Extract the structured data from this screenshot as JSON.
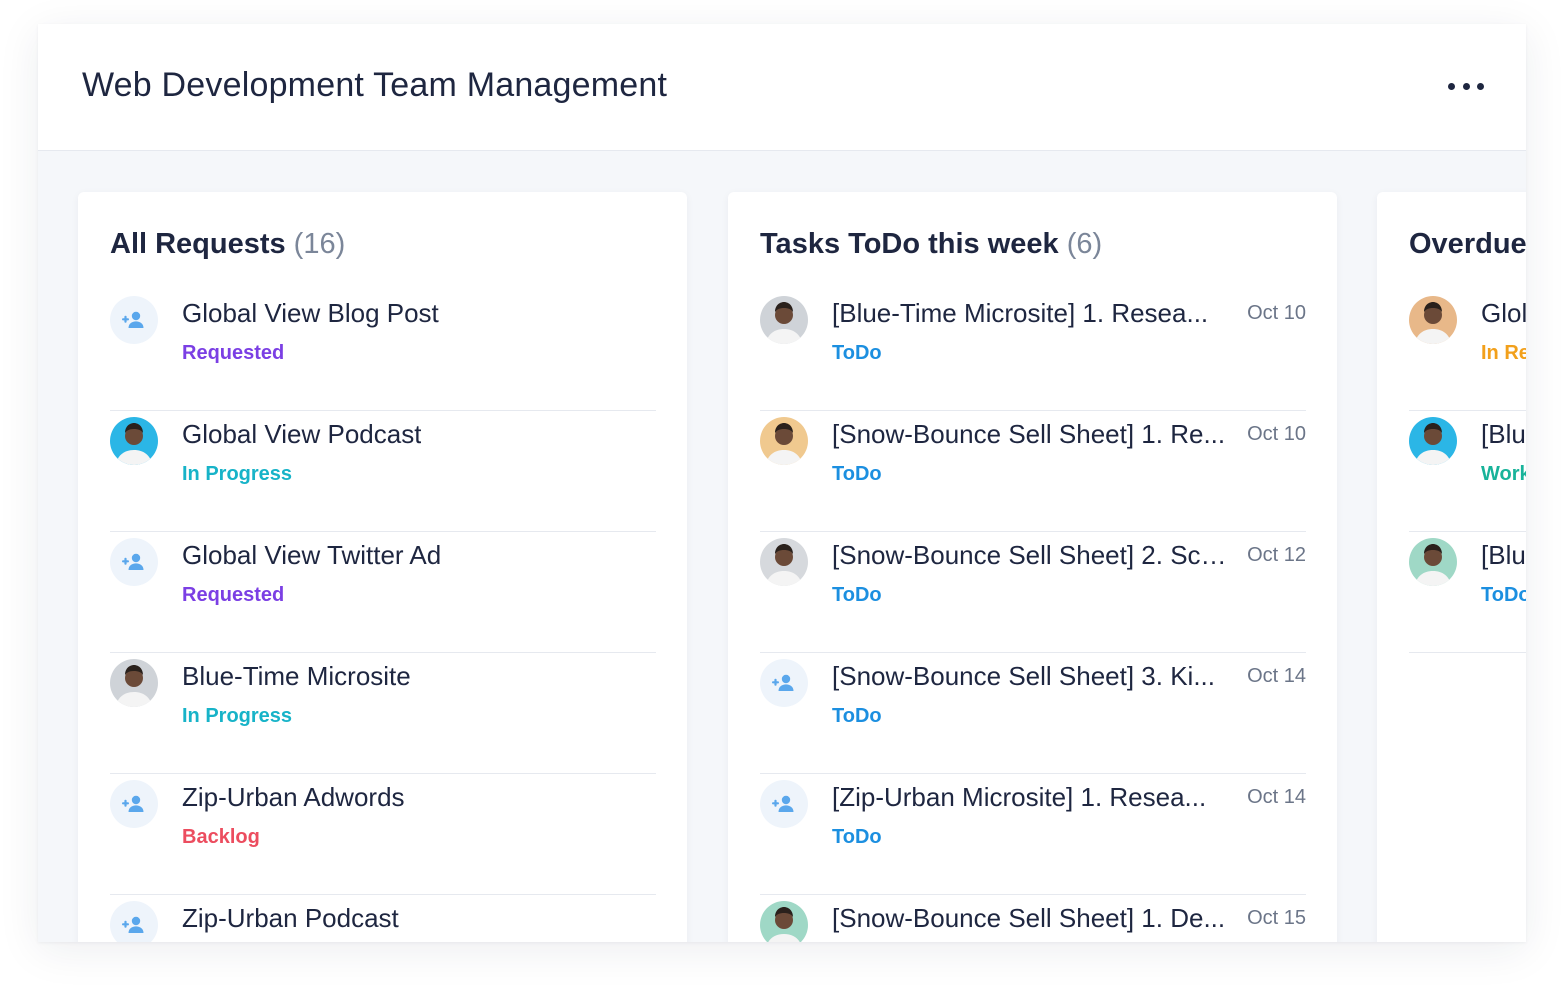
{
  "header": {
    "title": "Web Development Team Management"
  },
  "columns": [
    {
      "title": "All Requests",
      "count": "(16)",
      "items": [
        {
          "title": "Global View Blog Post",
          "status": "Requested",
          "status_color": "#7b3fe4",
          "avatar": "add-user-icon"
        },
        {
          "title": "Global View Podcast",
          "status": "In Progress",
          "status_color": "#17b3c8",
          "avatar": "person-photo"
        },
        {
          "title": "Global View Twitter Ad",
          "status": "Requested",
          "status_color": "#7b3fe4",
          "avatar": "add-user-icon"
        },
        {
          "title": "Blue-Time Microsite",
          "status": "In Progress",
          "status_color": "#17b3c8",
          "avatar": "person-photo"
        },
        {
          "title": "Zip-Urban Adwords",
          "status": "Backlog",
          "status_color": "#ec4d5f",
          "avatar": "add-user-icon"
        },
        {
          "title": "Zip-Urban Podcast",
          "status": "",
          "status_color": "#7b3fe4",
          "avatar": "add-user-icon"
        }
      ]
    },
    {
      "title": "Tasks ToDo this week",
      "count": "(6)",
      "items": [
        {
          "title": "[Blue-Time Microsite] 1. Resea...",
          "status": "ToDo",
          "status_color": "#1c8fe0",
          "date": "Oct 10",
          "avatar": "person-photo"
        },
        {
          "title": "[Snow-Bounce Sell Sheet] 1. Re...",
          "status": "ToDo",
          "status_color": "#1c8fe0",
          "date": "Oct 10",
          "avatar": "person-photo"
        },
        {
          "title": "[Snow-Bounce Sell Sheet] 2. Sco...",
          "status": "ToDo",
          "status_color": "#1c8fe0",
          "date": "Oct 12",
          "avatar": "person-photo"
        },
        {
          "title": "[Snow-Bounce Sell Sheet] 3. Ki...",
          "status": "ToDo",
          "status_color": "#1c8fe0",
          "date": "Oct 14",
          "avatar": "add-user-icon"
        },
        {
          "title": "[Zip-Urban Microsite] 1. Resea...",
          "status": "ToDo",
          "status_color": "#1c8fe0",
          "date": "Oct 14",
          "avatar": "add-user-icon"
        },
        {
          "title": "[Snow-Bounce Sell Sheet] 1. De...",
          "status": "",
          "status_color": "#1c8fe0",
          "date": "Oct 15",
          "avatar": "person-photo"
        }
      ]
    },
    {
      "title": "Overdue",
      "count": "",
      "items": [
        {
          "title": "Glol",
          "status": "In Re",
          "status_color": "#f2a01b",
          "avatar": "person-photo"
        },
        {
          "title": "[Blu",
          "status": "Work",
          "status_color": "#18b39a",
          "avatar": "person-photo"
        },
        {
          "title": "[Blu",
          "status": "ToDo",
          "status_color": "#1c8fe0",
          "avatar": "person-photo"
        }
      ]
    }
  ],
  "avatar_palette": [
    "#e8b889",
    "#2bb6e6",
    "#9fd8c6",
    "#cfd3d8",
    "#f0c98f",
    "#d6d9dd"
  ]
}
